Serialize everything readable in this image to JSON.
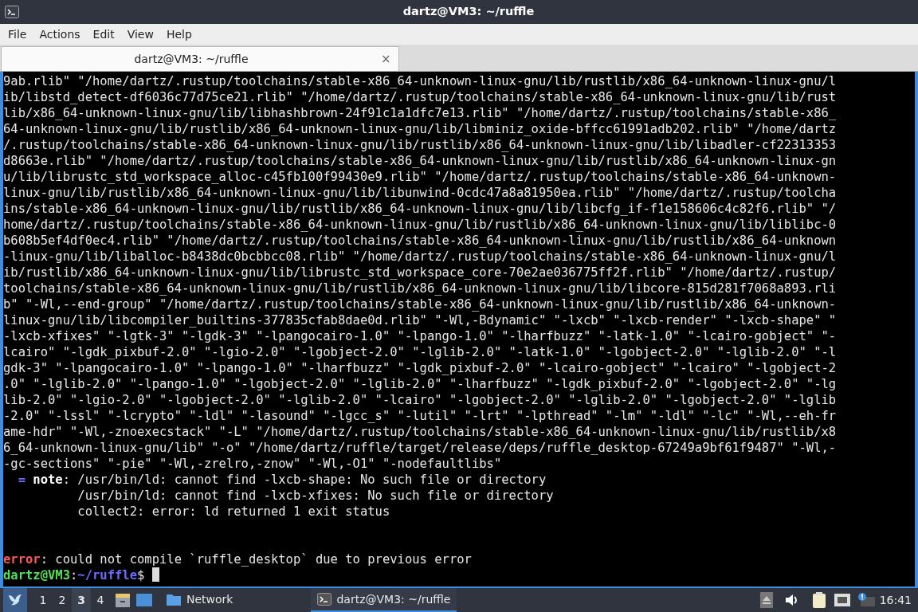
{
  "window": {
    "title": "dartz@VM3: ~/ruffle"
  },
  "menu": [
    "File",
    "Actions",
    "Edit",
    "View",
    "Help"
  ],
  "tabs": [
    {
      "label": "dartz@VM3: ~/ruffle",
      "selected": true,
      "close": "×"
    }
  ],
  "terminal": {
    "lines": [
      {
        "kind": "output",
        "segments": [
          {
            "kind": "plain",
            "text": "9ab.rlib\" \"/home/dartz/.rustup/toolchains/stable-x86_64-unknown-linux-gnu/lib/rustlib/x86_64-unknown-linux-gnu/l"
          }
        ]
      },
      {
        "kind": "output",
        "segments": [
          {
            "kind": "plain",
            "text": "ib/libstd_detect-df6036c77d75ce21.rlib\" \"/home/dartz/.rustup/toolchains/stable-x86_64-unknown-linux-gnu/lib/rust"
          }
        ]
      },
      {
        "kind": "output",
        "segments": [
          {
            "kind": "plain",
            "text": "lib/x86_64-unknown-linux-gnu/lib/libhashbrown-24f91c1a1dfc7e13.rlib\" \"/home/dartz/.rustup/toolchains/stable-x86_"
          }
        ]
      },
      {
        "kind": "output",
        "segments": [
          {
            "kind": "plain",
            "text": "64-unknown-linux-gnu/lib/rustlib/x86_64-unknown-linux-gnu/lib/libminiz_oxide-bffcc61991adb202.rlib\" \"/home/dartz"
          }
        ]
      },
      {
        "kind": "output",
        "segments": [
          {
            "kind": "plain",
            "text": "/.rustup/toolchains/stable-x86_64-unknown-linux-gnu/lib/rustlib/x86_64-unknown-linux-gnu/lib/libadler-cf22313353"
          }
        ]
      },
      {
        "kind": "output",
        "segments": [
          {
            "kind": "plain",
            "text": "d8663e.rlib\" \"/home/dartz/.rustup/toolchains/stable-x86_64-unknown-linux-gnu/lib/rustlib/x86_64-unknown-linux-gn"
          }
        ]
      },
      {
        "kind": "output",
        "segments": [
          {
            "kind": "plain",
            "text": "u/lib/librustc_std_workspace_alloc-c45fb100f99430e9.rlib\" \"/home/dartz/.rustup/toolchains/stable-x86_64-unknown-"
          }
        ]
      },
      {
        "kind": "output",
        "segments": [
          {
            "kind": "plain",
            "text": "linux-gnu/lib/rustlib/x86_64-unknown-linux-gnu/lib/libunwind-0cdc47a8a81950ea.rlib\" \"/home/dartz/.rustup/toolcha"
          }
        ]
      },
      {
        "kind": "output",
        "segments": [
          {
            "kind": "plain",
            "text": "ins/stable-x86_64-unknown-linux-gnu/lib/rustlib/x86_64-unknown-linux-gnu/lib/libcfg_if-f1e158606c4c82f6.rlib\" \"/"
          }
        ]
      },
      {
        "kind": "output",
        "segments": [
          {
            "kind": "plain",
            "text": "home/dartz/.rustup/toolchains/stable-x86_64-unknown-linux-gnu/lib/rustlib/x86_64-unknown-linux-gnu/lib/liblibc-0"
          }
        ]
      },
      {
        "kind": "output",
        "segments": [
          {
            "kind": "plain",
            "text": "b608b5ef4df0ec4.rlib\" \"/home/dartz/.rustup/toolchains/stable-x86_64-unknown-linux-gnu/lib/rustlib/x86_64-unknown"
          }
        ]
      },
      {
        "kind": "output",
        "segments": [
          {
            "kind": "plain",
            "text": "-linux-gnu/lib/liballoc-b8438dc0bcbbcc08.rlib\" \"/home/dartz/.rustup/toolchains/stable-x86_64-unknown-linux-gnu/l"
          }
        ]
      },
      {
        "kind": "output",
        "segments": [
          {
            "kind": "plain",
            "text": "ib/rustlib/x86_64-unknown-linux-gnu/lib/librustc_std_workspace_core-70e2ae036775ff2f.rlib\" \"/home/dartz/.rustup/"
          }
        ]
      },
      {
        "kind": "output",
        "segments": [
          {
            "kind": "plain",
            "text": "toolchains/stable-x86_64-unknown-linux-gnu/lib/rustlib/x86_64-unknown-linux-gnu/lib/libcore-815d281f7068a893.rli"
          }
        ]
      },
      {
        "kind": "output",
        "segments": [
          {
            "kind": "plain",
            "text": "b\" \"-Wl,--end-group\" \"/home/dartz/.rustup/toolchains/stable-x86_64-unknown-linux-gnu/lib/rustlib/x86_64-unknown-"
          }
        ]
      },
      {
        "kind": "output",
        "segments": [
          {
            "kind": "plain",
            "text": "linux-gnu/lib/libcompiler_builtins-377835cfab8dae0d.rlib\" \"-Wl,-Bdynamic\" \"-lxcb\" \"-lxcb-render\" \"-lxcb-shape\" \""
          }
        ]
      },
      {
        "kind": "output",
        "segments": [
          {
            "kind": "plain",
            "text": "-lxcb-xfixes\" \"-lgtk-3\" \"-lgdk-3\" \"-lpangocairo-1.0\" \"-lpango-1.0\" \"-lharfbuzz\" \"-latk-1.0\" \"-lcairo-gobject\" \"-"
          }
        ]
      },
      {
        "kind": "output",
        "segments": [
          {
            "kind": "plain",
            "text": "lcairo\" \"-lgdk_pixbuf-2.0\" \"-lgio-2.0\" \"-lgobject-2.0\" \"-lglib-2.0\" \"-latk-1.0\" \"-lgobject-2.0\" \"-lglib-2.0\" \"-l"
          }
        ]
      },
      {
        "kind": "output",
        "segments": [
          {
            "kind": "plain",
            "text": "gdk-3\" \"-lpangocairo-1.0\" \"-lpango-1.0\" \"-lharfbuzz\" \"-lgdk_pixbuf-2.0\" \"-lcairo-gobject\" \"-lcairo\" \"-lgobject-2"
          }
        ]
      },
      {
        "kind": "output",
        "segments": [
          {
            "kind": "plain",
            "text": ".0\" \"-lglib-2.0\" \"-lpango-1.0\" \"-lgobject-2.0\" \"-lglib-2.0\" \"-lharfbuzz\" \"-lgdk_pixbuf-2.0\" \"-lgobject-2.0\" \"-lg"
          }
        ]
      },
      {
        "kind": "output",
        "segments": [
          {
            "kind": "plain",
            "text": "lib-2.0\" \"-lgio-2.0\" \"-lgobject-2.0\" \"-lglib-2.0\" \"-lcairo\" \"-lgobject-2.0\" \"-lglib-2.0\" \"-lgobject-2.0\" \"-lglib"
          }
        ]
      },
      {
        "kind": "output",
        "segments": [
          {
            "kind": "plain",
            "text": "-2.0\" \"-lssl\" \"-lcrypto\" \"-ldl\" \"-lasound\" \"-lgcc_s\" \"-lutil\" \"-lrt\" \"-lpthread\" \"-lm\" \"-ldl\" \"-lc\" \"-Wl,--eh-fr"
          }
        ]
      },
      {
        "kind": "output",
        "segments": [
          {
            "kind": "plain",
            "text": "ame-hdr\" \"-Wl,-znoexecstack\" \"-L\" \"/home/dartz/.rustup/toolchains/stable-x86_64-unknown-linux-gnu/lib/rustlib/x8"
          }
        ]
      },
      {
        "kind": "output",
        "segments": [
          {
            "kind": "plain",
            "text": "6_64-unknown-linux-gnu/lib\" \"-o\" \"/home/dartz/ruffle/target/release/deps/ruffle_desktop-67249a9bf61f9487\" \"-Wl,-"
          }
        ]
      },
      {
        "kind": "output",
        "segments": [
          {
            "kind": "plain",
            "text": "-gc-sections\" \"-pie\" \"-Wl,-zrelro,-znow\" \"-Wl,-O1\" \"-nodefaultlibs\""
          }
        ]
      },
      {
        "kind": "output",
        "segments": [
          {
            "kind": "marker",
            "text": "  ="
          },
          {
            "kind": "label",
            "text": " note"
          },
          {
            "kind": "plain",
            "text": ": /usr/bin/ld: cannot find -lxcb-shape: No such file or directory"
          }
        ]
      },
      {
        "kind": "output",
        "segments": [
          {
            "kind": "plain",
            "text": "          /usr/bin/ld: cannot find -lxcb-xfixes: No such file or directory"
          }
        ]
      },
      {
        "kind": "output",
        "segments": [
          {
            "kind": "plain",
            "text": "          collect2: error: ld returned 1 exit status"
          }
        ]
      },
      {
        "kind": "summary",
        "segments": [
          {
            "kind": "error",
            "text": "error"
          },
          {
            "kind": "plain",
            "text": ": could not compile `ruffle_desktop` due to previous error"
          }
        ]
      },
      {
        "kind": "prompt",
        "segments": [
          {
            "kind": "user",
            "text": "dartz@VM3"
          },
          {
            "kind": "plain",
            "text": ":"
          },
          {
            "kind": "path",
            "text": "~/ruffle"
          },
          {
            "kind": "plain",
            "text": "$ "
          }
        ]
      }
    ]
  },
  "taskbar": {
    "workspaces": [
      {
        "label": "1",
        "selected": false
      },
      {
        "label": "2",
        "selected": false
      },
      {
        "label": "3",
        "selected": true
      },
      {
        "label": "4",
        "selected": false
      }
    ],
    "tasks": [
      {
        "kind": "folder",
        "label": "Network",
        "selected": false
      },
      {
        "kind": "terminal",
        "label": "dartz@VM3: ~/ruffle",
        "selected": true
      }
    ],
    "clock": "16:41"
  }
}
